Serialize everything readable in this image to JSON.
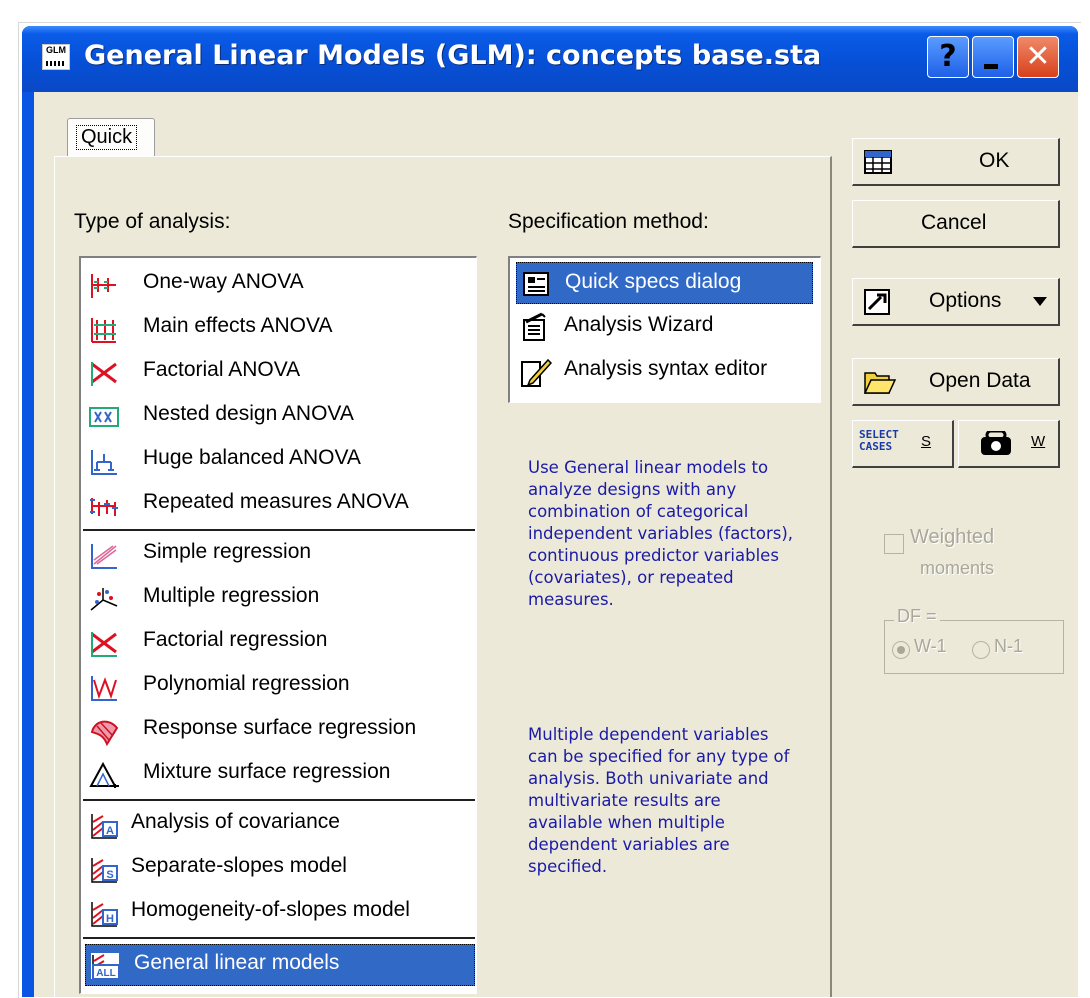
{
  "window": {
    "title": "General Linear Models (GLM): concepts base.sta",
    "icon_label": "GLM",
    "help_label": "?",
    "close_label": "✕"
  },
  "tabs": [
    {
      "label": "Quick"
    }
  ],
  "type_of_analysis": {
    "label": "Type of analysis:",
    "groups": [
      {
        "items": [
          {
            "label": "One-way ANOVA",
            "icon": "oneway-anova-icon"
          },
          {
            "label": "Main effects ANOVA",
            "icon": "main-effects-icon"
          },
          {
            "label": "Factorial ANOVA",
            "icon": "factorial-anova-icon"
          },
          {
            "label": "Nested design ANOVA",
            "icon": "nested-design-icon"
          },
          {
            "label": "Huge balanced ANOVA",
            "icon": "huge-balanced-icon"
          },
          {
            "label": "Repeated measures ANOVA",
            "icon": "repeated-measures-icon"
          }
        ]
      },
      {
        "items": [
          {
            "label": "Simple regression",
            "icon": "simple-regression-icon"
          },
          {
            "label": "Multiple regression",
            "icon": "multiple-regression-icon"
          },
          {
            "label": "Factorial regression",
            "icon": "factorial-regression-icon"
          },
          {
            "label": "Polynomial regression",
            "icon": "polynomial-regression-icon"
          },
          {
            "label": "Response surface regression",
            "icon": "response-surface-icon"
          },
          {
            "label": "Mixture surface regression",
            "icon": "mixture-surface-icon"
          }
        ]
      },
      {
        "items": [
          {
            "label": "Analysis of covariance",
            "icon": "ancova-icon"
          },
          {
            "label": "Separate-slopes model",
            "icon": "separate-slopes-icon"
          },
          {
            "label": "Homogeneity-of-slopes model",
            "icon": "homogeneity-slopes-icon"
          }
        ]
      },
      {
        "items": [
          {
            "label": "General linear models",
            "icon": "general-linear-models-icon",
            "selected": true
          }
        ]
      }
    ]
  },
  "specification_method": {
    "label": "Specification method:",
    "items": [
      {
        "label": "Quick specs dialog",
        "icon": "quick-specs-icon",
        "selected": true
      },
      {
        "label": "Analysis Wizard",
        "icon": "wizard-icon"
      },
      {
        "label": "Analysis syntax editor",
        "icon": "syntax-editor-icon"
      }
    ]
  },
  "description": {
    "paragraph1": "Use General linear models to analyze designs with any combination of categorical independent variables (factors), continuous predictor variables (covariates), or repeated measures.",
    "paragraph2": "Multiple dependent variables can be specified for any type of analysis.  Both univariate and multivariate results are available when multiple dependent variables are specified."
  },
  "buttons": {
    "ok": "OK",
    "cancel": "Cancel",
    "options": "Options",
    "open_data": "Open Data",
    "select_cases_top": "SELECT",
    "select_cases_bottom": "CASES",
    "select_cases_key": "S",
    "weight_key": "W"
  },
  "weighted_moments": {
    "label_line1": "Weighted",
    "label_line2": "moments",
    "checked": false
  },
  "df": {
    "label": "DF =",
    "options": [
      "W-1",
      "N-1"
    ],
    "selected": "W-1"
  },
  "colors": {
    "titlebar": "#0a54e3",
    "selection": "#3169c6",
    "dialog_bg": "#ece9d8",
    "description_text": "#1a1aa8"
  }
}
